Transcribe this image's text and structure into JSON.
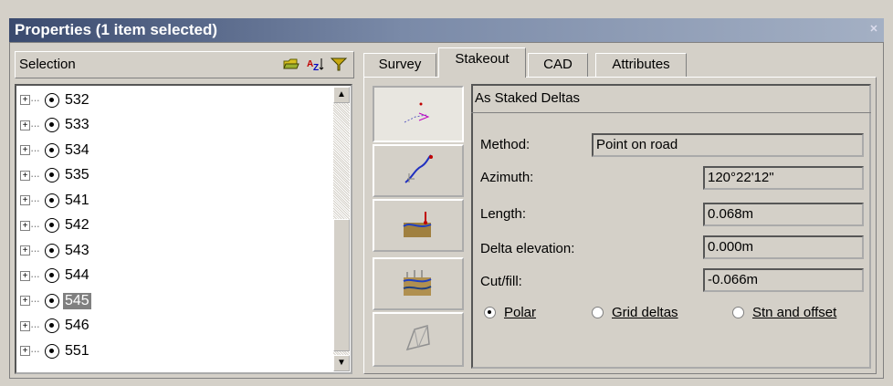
{
  "window": {
    "title": "Properties (1 item selected)",
    "close_glyph": "✕"
  },
  "selection": {
    "header_label": "Selection",
    "icons": [
      "folder-icon",
      "sort-az-icon",
      "filter-icon"
    ],
    "items": [
      {
        "label": "532",
        "selected": false
      },
      {
        "label": "533",
        "selected": false
      },
      {
        "label": "534",
        "selected": false
      },
      {
        "label": "535",
        "selected": false
      },
      {
        "label": "541",
        "selected": false
      },
      {
        "label": "542",
        "selected": false
      },
      {
        "label": "543",
        "selected": false
      },
      {
        "label": "544",
        "selected": false
      },
      {
        "label": "545",
        "selected": true
      },
      {
        "label": "546",
        "selected": false
      },
      {
        "label": "551",
        "selected": false
      }
    ]
  },
  "tabs": [
    {
      "label": "Survey",
      "active": false
    },
    {
      "label": "Stakeout",
      "active": true
    },
    {
      "label": "CAD",
      "active": false
    },
    {
      "label": "Attributes",
      "active": false
    }
  ],
  "side_buttons": [
    "stakeout-point-icon",
    "stakeout-line-icon",
    "stakeout-surface-icon",
    "stakeout-layers-icon",
    "stakeout-3d-icon"
  ],
  "stakeout": {
    "section_title": "As Staked Deltas",
    "fields": [
      {
        "label": "Method:",
        "value": "Point on road"
      },
      {
        "label": "Azimuth:",
        "value": "120°22'12\""
      },
      {
        "label": "Length:",
        "value": "0.068m"
      },
      {
        "label": "Delta elevation:",
        "value": "0.000m"
      },
      {
        "label": "Cut/fill:",
        "value": "-0.066m"
      }
    ],
    "radios": [
      {
        "label": "Polar",
        "checked": true
      },
      {
        "label": "Grid deltas",
        "checked": false
      },
      {
        "label": "Stn and offset",
        "checked": false
      }
    ]
  }
}
